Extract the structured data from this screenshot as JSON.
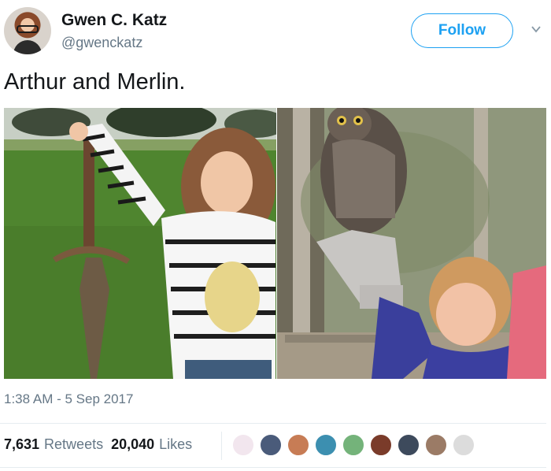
{
  "tweet": {
    "author_name": "Gwen C. Katz",
    "handle": "@gwenckatz",
    "follow_label": "Follow",
    "text": "Arthur and Merlin.",
    "timestamp": "1:38 AM - 5 Sep 2017",
    "retweets_count": "7,631",
    "retweets_label": "Retweets",
    "likes_count": "20,040",
    "likes_label": "Likes"
  },
  "icons": {
    "more": "chevron-down-icon"
  },
  "colors": {
    "accent": "#1da1f2",
    "secondary_text": "#657786",
    "primary_text": "#14171a"
  },
  "liker_avatars": [
    {
      "color": "#f2e6ee"
    },
    {
      "color": "#4a5b7a"
    },
    {
      "color": "#c77c55"
    },
    {
      "color": "#3c8fb0"
    },
    {
      "color": "#74b37a"
    },
    {
      "color": "#7a3b2a"
    },
    {
      "color": "#3d4a5c"
    },
    {
      "color": "#9b7b66"
    },
    {
      "color": "#dcdcdc"
    }
  ]
}
